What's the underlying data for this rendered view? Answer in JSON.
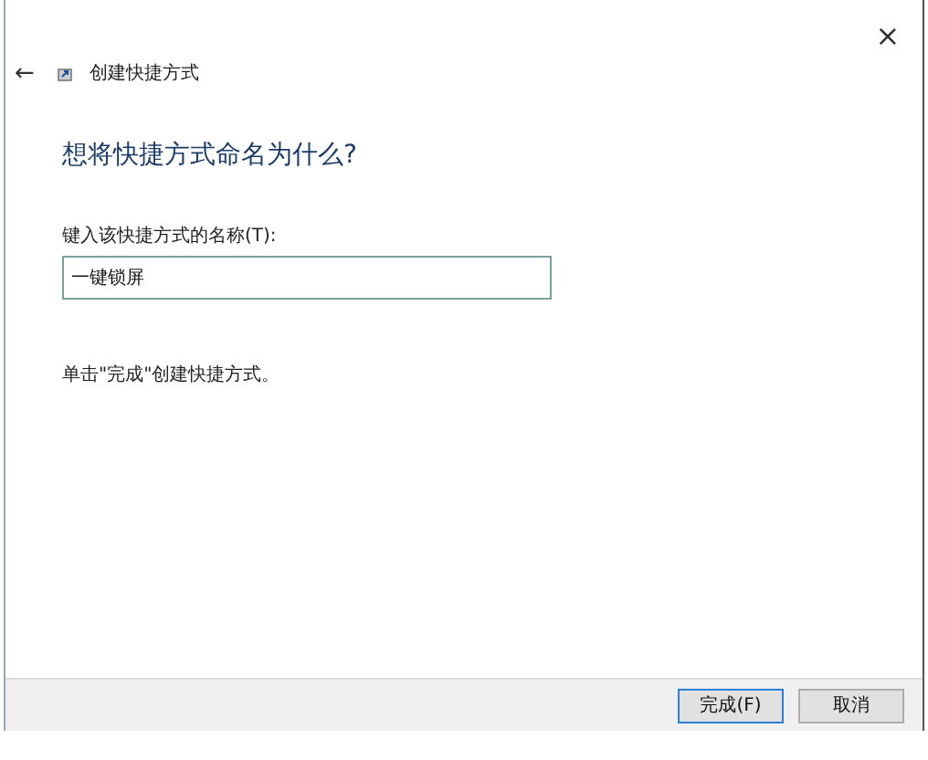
{
  "window": {
    "close": "×"
  },
  "header": {
    "back": "←",
    "title": "创建快捷方式"
  },
  "heading": "想将快捷方式命名为什么?",
  "name_field": {
    "label": "键入该快捷方式的名称(T):",
    "value": "一键锁屏"
  },
  "instruction": "单击\"完成\"创建快捷方式。",
  "buttons": [
    {
      "label": "完成(F)",
      "kind": "primary"
    },
    {
      "label": "取消",
      "kind": "normal"
    }
  ]
}
